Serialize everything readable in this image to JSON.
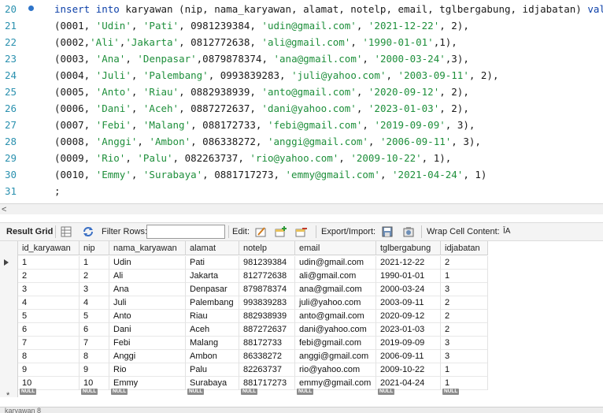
{
  "editor": {
    "lines": [
      {
        "n": "20",
        "tokens": [
          [
            "kw",
            "insert"
          ],
          [
            "p",
            " "
          ],
          [
            "kw",
            "into"
          ],
          [
            "p",
            " karyawan (nip, nama_karyawan, alamat, notelp, email, tglbergabung, idjabatan) "
          ],
          [
            "kw",
            "values"
          ]
        ]
      },
      {
        "n": "21",
        "tokens": [
          [
            "p",
            "(0001, "
          ],
          [
            "str",
            "'Udin'"
          ],
          [
            "p",
            ", "
          ],
          [
            "str",
            "'Pati'"
          ],
          [
            "p",
            ", 0981239384, "
          ],
          [
            "str",
            "'udin@gmail.com'"
          ],
          [
            "p",
            ", "
          ],
          [
            "str",
            "'2021-12-22'"
          ],
          [
            "p",
            ", 2),"
          ]
        ]
      },
      {
        "n": "22",
        "tokens": [
          [
            "p",
            "(0002,"
          ],
          [
            "str",
            "'Ali'"
          ],
          [
            "p",
            ","
          ],
          [
            "str",
            "'Jakarta'"
          ],
          [
            "p",
            ", 0812772638, "
          ],
          [
            "str",
            "'ali@gmail.com'"
          ],
          [
            "p",
            ", "
          ],
          [
            "str",
            "'1990-01-01'"
          ],
          [
            "p",
            ",1),"
          ]
        ]
      },
      {
        "n": "23",
        "tokens": [
          [
            "p",
            "(0003, "
          ],
          [
            "str",
            "'Ana'"
          ],
          [
            "p",
            ", "
          ],
          [
            "str",
            "'Denpasar'"
          ],
          [
            "p",
            ",0879878374, "
          ],
          [
            "str",
            "'ana@gmail.com'"
          ],
          [
            "p",
            ", "
          ],
          [
            "str",
            "'2000-03-24'"
          ],
          [
            "p",
            ",3),"
          ]
        ]
      },
      {
        "n": "24",
        "tokens": [
          [
            "p",
            "(0004, "
          ],
          [
            "str",
            "'Juli'"
          ],
          [
            "p",
            ", "
          ],
          [
            "str",
            "'Palembang'"
          ],
          [
            "p",
            ", 0993839283, "
          ],
          [
            "str",
            "'juli@yahoo.com'"
          ],
          [
            "p",
            ", "
          ],
          [
            "str",
            "'2003-09-11'"
          ],
          [
            "p",
            ", 2),"
          ]
        ]
      },
      {
        "n": "25",
        "tokens": [
          [
            "p",
            "(0005, "
          ],
          [
            "str",
            "'Anto'"
          ],
          [
            "p",
            ", "
          ],
          [
            "str",
            "'Riau'"
          ],
          [
            "p",
            ", 0882938939, "
          ],
          [
            "str",
            "'anto@gmail.com'"
          ],
          [
            "p",
            ", "
          ],
          [
            "str",
            "'2020-09-12'"
          ],
          [
            "p",
            ", 2),"
          ]
        ]
      },
      {
        "n": "26",
        "tokens": [
          [
            "p",
            "(0006, "
          ],
          [
            "str",
            "'Dani'"
          ],
          [
            "p",
            ", "
          ],
          [
            "str",
            "'Aceh'"
          ],
          [
            "p",
            ", 0887272637, "
          ],
          [
            "str",
            "'dani@yahoo.com'"
          ],
          [
            "p",
            ", "
          ],
          [
            "str",
            "'2023-01-03'"
          ],
          [
            "p",
            ", 2),"
          ]
        ]
      },
      {
        "n": "27",
        "tokens": [
          [
            "p",
            "(0007, "
          ],
          [
            "str",
            "'Febi'"
          ],
          [
            "p",
            ", "
          ],
          [
            "str",
            "'Malang'"
          ],
          [
            "p",
            ", 088172733, "
          ],
          [
            "str",
            "'febi@gmail.com'"
          ],
          [
            "p",
            ", "
          ],
          [
            "str",
            "'2019-09-09'"
          ],
          [
            "p",
            ", 3),"
          ]
        ]
      },
      {
        "n": "28",
        "tokens": [
          [
            "p",
            "(0008, "
          ],
          [
            "str",
            "'Anggi'"
          ],
          [
            "p",
            ", "
          ],
          [
            "str",
            "'Ambon'"
          ],
          [
            "p",
            ", 086338272, "
          ],
          [
            "str",
            "'anggi@gmail.com'"
          ],
          [
            "p",
            ", "
          ],
          [
            "str",
            "'2006-09-11'"
          ],
          [
            "p",
            ", 3),"
          ]
        ]
      },
      {
        "n": "29",
        "tokens": [
          [
            "p",
            "(0009, "
          ],
          [
            "str",
            "'Rio'"
          ],
          [
            "p",
            ", "
          ],
          [
            "str",
            "'Palu'"
          ],
          [
            "p",
            ", 082263737, "
          ],
          [
            "str",
            "'rio@yahoo.com'"
          ],
          [
            "p",
            ", "
          ],
          [
            "str",
            "'2009-10-22'"
          ],
          [
            "p",
            ", 1),"
          ]
        ]
      },
      {
        "n": "30",
        "tokens": [
          [
            "p",
            "(0010, "
          ],
          [
            "str",
            "'Emmy'"
          ],
          [
            "p",
            ", "
          ],
          [
            "str",
            "'Surabaya'"
          ],
          [
            "p",
            ", 0881717273, "
          ],
          [
            "str",
            "'emmy@gmail.com'"
          ],
          [
            "p",
            ", "
          ],
          [
            "str",
            "'2021-04-24'"
          ],
          [
            "p",
            ", 1)"
          ]
        ]
      },
      {
        "n": "31",
        "tokens": [
          [
            "p",
            ";"
          ]
        ]
      }
    ],
    "scroll_left_arrow": "<"
  },
  "toolbar": {
    "result_grid": "Result Grid",
    "filter_rows": "Filter Rows:",
    "filter_value": "",
    "edit": "Edit:",
    "export_import": "Export/Import:",
    "wrap_cell": "Wrap Cell Content:",
    "wrap_icon": "ĪA"
  },
  "grid": {
    "columns": [
      "id_karyawan",
      "nip",
      "nama_karyawan",
      "alamat",
      "notelp",
      "email",
      "tglbergabung",
      "idjabatan"
    ],
    "rows": [
      [
        "1",
        "1",
        "Udin",
        "Pati",
        "981239384",
        "udin@gmail.com",
        "2021-12-22",
        "2"
      ],
      [
        "2",
        "2",
        "Ali",
        "Jakarta",
        "812772638",
        "ali@gmail.com",
        "1990-01-01",
        "1"
      ],
      [
        "3",
        "3",
        "Ana",
        "Denpasar",
        "879878374",
        "ana@gmail.com",
        "2000-03-24",
        "3"
      ],
      [
        "4",
        "4",
        "Juli",
        "Palembang",
        "993839283",
        "juli@yahoo.com",
        "2003-09-11",
        "2"
      ],
      [
        "5",
        "5",
        "Anto",
        "Riau",
        "882938939",
        "anto@gmail.com",
        "2020-09-12",
        "2"
      ],
      [
        "6",
        "6",
        "Dani",
        "Aceh",
        "887272637",
        "dani@yahoo.com",
        "2023-01-03",
        "2"
      ],
      [
        "7",
        "7",
        "Febi",
        "Malang",
        "88172733",
        "febi@gmail.com",
        "2019-09-09",
        "3"
      ],
      [
        "8",
        "8",
        "Anggi",
        "Ambon",
        "86338272",
        "anggi@gmail.com",
        "2006-09-11",
        "3"
      ],
      [
        "9",
        "9",
        "Rio",
        "Palu",
        "82263737",
        "rio@yahoo.com",
        "2009-10-22",
        "1"
      ],
      [
        "10",
        "10",
        "Emmy",
        "Surabaya",
        "881717273",
        "emmy@gmail.com",
        "2021-04-24",
        "1"
      ]
    ],
    "null_label": "NULL",
    "new_row_marker": "*"
  },
  "bottom_tab": "karyawan 8",
  "colors": {
    "keyword": "#0b3fa8",
    "string": "#1e8f3b",
    "line_number": "#2b91af"
  }
}
